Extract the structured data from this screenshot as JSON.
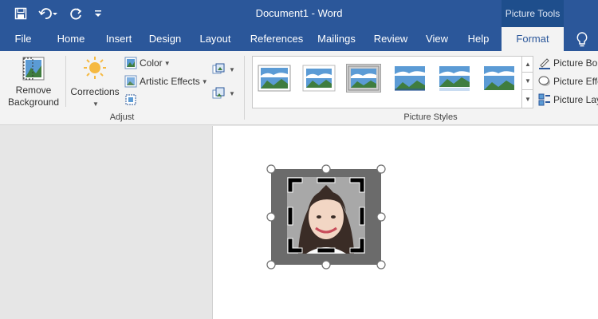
{
  "window": {
    "title": "Document1  -  Word",
    "context_tab_group": "Picture Tools"
  },
  "tabs": [
    "File",
    "Home",
    "Insert",
    "Design",
    "Layout",
    "References",
    "Mailings",
    "Review",
    "View",
    "Help",
    "Format"
  ],
  "active_tab": "Format",
  "ribbon": {
    "remove_background": {
      "line1": "Remove",
      "line2": "Background"
    },
    "corrections": "Corrections",
    "color": "Color",
    "artistic_effects": "Artistic Effects",
    "adjust_group_label": "Adjust",
    "picture_styles_group_label": "Picture Styles",
    "picture_border": "Picture Bor",
    "picture_effects": "Picture Effe",
    "picture_layout": "Picture Lay"
  },
  "colors": {
    "title_bar": "#2b579a",
    "context_group": "#1e4e8c",
    "ribbon_bg": "#f3f3f3",
    "page": "#ffffff"
  }
}
